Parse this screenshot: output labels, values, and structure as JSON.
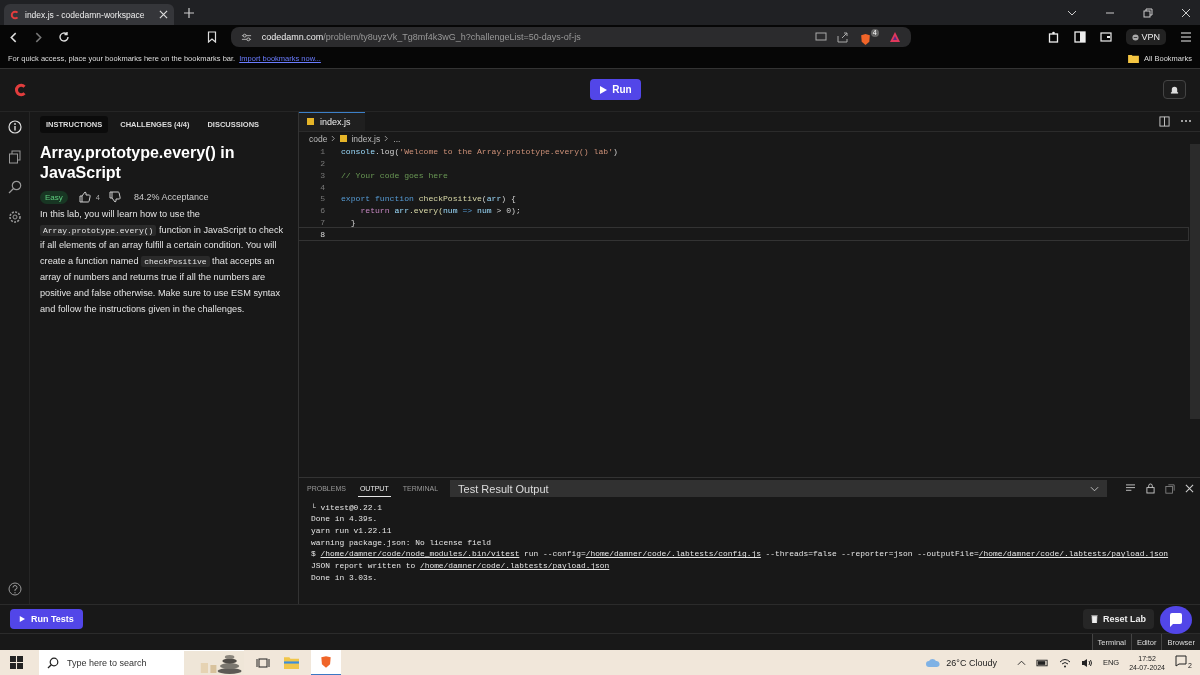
{
  "browser": {
    "tab_title": "index.js - codedamn-workspace",
    "url_host": "codedamn.com",
    "url_path": "/problem/ty8uyzVk_Tg8mf4k3wG_h?challengeList=50-days-of-js",
    "shields_count": "4",
    "vpn_label": "VPN",
    "bookmarks_hint": "For quick access, place your bookmarks here on the bookmarks bar.",
    "bookmarks_link": "Import bookmarks now...",
    "all_bookmarks": "All Bookmarks"
  },
  "header": {
    "run_label": "Run"
  },
  "left_tabs": [
    {
      "label": "INSTRUCTIONS",
      "selected": true
    },
    {
      "label": "CHALLENGES (4/4)",
      "selected": false
    },
    {
      "label": "DISCUSSIONS",
      "selected": false
    }
  ],
  "lesson": {
    "title": "Array.prototype.every() in JavaScript",
    "difficulty": "Easy",
    "likes": "4",
    "acceptance": "84.2% Acceptance",
    "body": [
      {
        "text": "In this lab, you will learn how to use the ",
        "kind": "text"
      },
      {
        "text": "Array.prototype.every()",
        "kind": "code"
      },
      {
        "text": " function in JavaScript to check if all elements of an array fulfill a certain condition. You will create a function named ",
        "kind": "text"
      },
      {
        "text": "checkPositive",
        "kind": "code"
      },
      {
        "text": " that accepts an array of numbers and returns true if all the numbers are positive and false otherwise. Make sure to use ESM syntax and follow the instructions given in the challenges.",
        "kind": "text"
      }
    ]
  },
  "editor": {
    "tab": "index.js",
    "breadcrumb": [
      "code",
      "index.js",
      "..."
    ],
    "lines": [
      {
        "number": "1",
        "selected": false,
        "tokens": [
          {
            "text": "console",
            "kind": "var"
          },
          {
            "text": ".log(",
            "kind": "plain"
          },
          {
            "text": "'Welcome to the Array.prototype.every() lab'",
            "kind": "string"
          },
          {
            "text": ")",
            "kind": "plain"
          }
        ]
      },
      {
        "number": "2",
        "selected": false
      },
      {
        "number": "3",
        "selected": false,
        "tokens": [
          {
            "text": "// Your code goes here",
            "kind": "comment"
          }
        ]
      },
      {
        "number": "4",
        "selected": false
      },
      {
        "number": "5",
        "selected": false,
        "tokens": [
          {
            "text": "export function",
            "kind": "keyword"
          },
          {
            "text": " checkPositive",
            "kind": "func"
          },
          {
            "text": "(",
            "kind": "plain"
          },
          {
            "text": "arr",
            "kind": "var"
          },
          {
            "text": ") {",
            "kind": "plain"
          }
        ]
      },
      {
        "number": "6",
        "selected": false,
        "tokens": [
          {
            "text": "    return",
            "kind": "control"
          },
          {
            "text": " arr",
            "kind": "var"
          },
          {
            "text": ".every(",
            "kind": "func"
          },
          {
            "text": "num",
            "kind": "var"
          },
          {
            "text": " => ",
            "kind": "keyword"
          },
          {
            "text": "num",
            "kind": "var"
          },
          {
            "text": " > 0);",
            "kind": "plain"
          }
        ]
      },
      {
        "number": "7",
        "selected": false,
        "tokens": [
          {
            "text": "  }",
            "kind": "plain"
          }
        ]
      },
      {
        "number": "8",
        "selected": true
      }
    ]
  },
  "panel": {
    "tabs": [
      {
        "label": "PROBLEMS",
        "selected": false
      },
      {
        "label": "OUTPUT",
        "selected": true
      },
      {
        "label": "TERMINAL",
        "selected": false
      }
    ],
    "channel": "Test Result Output",
    "lines": [
      [
        {
          "text": "└ vitest@0.22.1",
          "kind": "text"
        }
      ],
      [
        {
          "text": "Done in 4.39s.",
          "kind": "text"
        }
      ],
      [
        {
          "text": "yarn run v1.22.11",
          "kind": "text"
        }
      ],
      [
        {
          "text": "warning package.json: No license field",
          "kind": "text"
        }
      ],
      [
        {
          "text": "$ ",
          "kind": "text"
        },
        {
          "text": "/home/damner/code/node_modules/.bin/vitest",
          "kind": "path"
        },
        {
          "text": " run --config=",
          "kind": "text"
        },
        {
          "text": "/home/damner/code/.labtests/config.js",
          "kind": "path"
        },
        {
          "text": " --threads=false --reporter=json --outputFile=",
          "kind": "text"
        },
        {
          "text": "/home/damner/code/.labtests/payload.json",
          "kind": "path"
        }
      ],
      [
        {
          "text": "JSON report written to ",
          "kind": "text"
        },
        {
          "text": "/home/damner/code/.labtests/payload.json",
          "kind": "path"
        }
      ],
      [
        {
          "text": "Done in 3.03s.",
          "kind": "text"
        }
      ]
    ]
  },
  "footer": {
    "run_tests": "Run Tests",
    "reset": "Reset Lab"
  },
  "view_tabs": [
    {
      "label": "Terminal",
      "selected": false
    },
    {
      "label": "Editor",
      "selected": false
    },
    {
      "label": "Browser",
      "selected": false
    }
  ],
  "taskbar": {
    "search_placeholder": "Type here to search",
    "weather": "26°C Cloudy",
    "language": "ENG",
    "time": "17:52",
    "date": "24-07-2024",
    "notifications": "2"
  }
}
